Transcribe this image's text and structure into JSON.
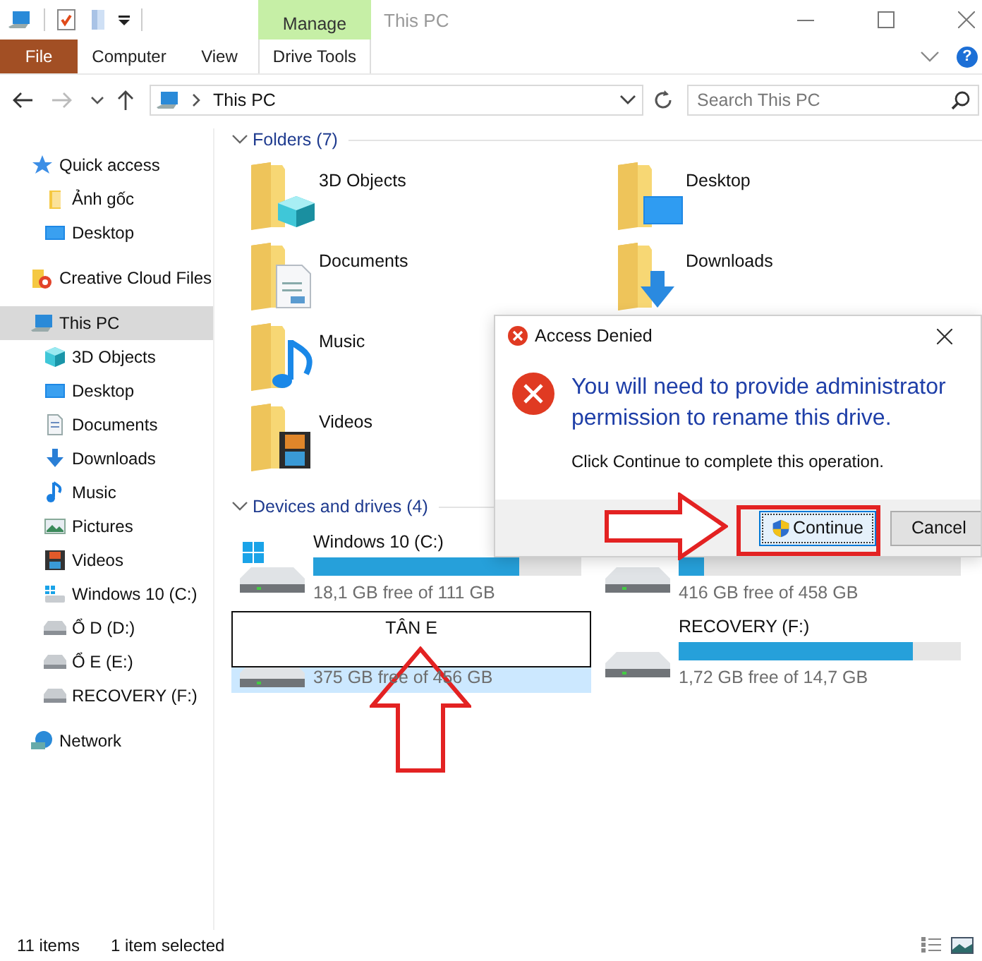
{
  "window": {
    "title": "This PC",
    "context_group": "Manage"
  },
  "ribbon": {
    "tabs": [
      {
        "label": "File",
        "kind": "file"
      },
      {
        "label": "Computer",
        "kind": "normal"
      },
      {
        "label": "View",
        "kind": "normal"
      },
      {
        "label": "Drive Tools",
        "kind": "context"
      }
    ],
    "help": "?"
  },
  "address": {
    "location": "This PC"
  },
  "search": {
    "placeholder": "Search This PC"
  },
  "sidebar": {
    "items": [
      {
        "label": "Quick access",
        "kind": "star",
        "selected": false,
        "children": [
          {
            "label": "Ảnh gốc",
            "kind": "folder",
            "selected": false
          },
          {
            "label": "Desktop",
            "kind": "desktop",
            "selected": false
          }
        ]
      },
      {
        "label": "Creative Cloud Files",
        "kind": "cloud",
        "selected": false
      },
      {
        "label": "This PC",
        "kind": "pc",
        "selected": true,
        "children": [
          {
            "label": "3D Objects",
            "kind": "cube",
            "selected": false
          },
          {
            "label": "Desktop",
            "kind": "desktop",
            "selected": false
          },
          {
            "label": "Documents",
            "kind": "doc",
            "selected": false
          },
          {
            "label": "Downloads",
            "kind": "download",
            "selected": false
          },
          {
            "label": "Music",
            "kind": "music",
            "selected": false
          },
          {
            "label": "Pictures",
            "kind": "pictures",
            "selected": false
          },
          {
            "label": "Videos",
            "kind": "video",
            "selected": false
          },
          {
            "label": "Windows 10 (C:)",
            "kind": "windrive",
            "selected": false
          },
          {
            "label": "Ổ D (D:)",
            "kind": "drive",
            "selected": false
          },
          {
            "label": "Ổ E (E:)",
            "kind": "drive",
            "selected": false
          },
          {
            "label": "RECOVERY (F:)",
            "kind": "drive",
            "selected": false
          }
        ]
      },
      {
        "label": "Network",
        "kind": "network",
        "selected": false
      }
    ]
  },
  "folders": {
    "header": "Folders (7)",
    "columns": [
      [
        {
          "label": "3D Objects",
          "kind": "cube"
        },
        {
          "label": "Documents",
          "kind": "doc"
        },
        {
          "label": "Music",
          "kind": "music"
        },
        {
          "label": "Videos",
          "kind": "video"
        }
      ],
      [
        {
          "label": "Desktop",
          "kind": "desktop"
        },
        {
          "label": "Downloads",
          "kind": "download"
        }
      ]
    ]
  },
  "drives": {
    "header": "Devices and drives (4)",
    "items": [
      {
        "name": "Windows 10 (C:)",
        "kind": "windrive",
        "level": 0.77,
        "free": "18,1 GB free of 111 GB",
        "selected": false
      },
      {
        "kind": "drive",
        "level": 0.09,
        "free": "416 GB free of 458 GB",
        "selected": false
      },
      {
        "kind": "drive",
        "rename_value": "TÂN E",
        "free": "375 GB free of 456 GB",
        "selected": true
      },
      {
        "name": "RECOVERY (F:)",
        "kind": "drive",
        "level": 0.83,
        "free": "1,72 GB free of 14,7 GB",
        "selected": false
      }
    ]
  },
  "dialog": {
    "title": "Access Denied",
    "message": "You will need to provide administrator permission to rename this drive.",
    "detail": "Click Continue to complete this operation.",
    "buttons": [
      {
        "label": "Continue",
        "kind": "uac",
        "focused": true
      },
      {
        "label": "Cancel",
        "kind": "plain",
        "focused": false
      }
    ]
  },
  "status_bar": [
    "11 items",
    "1 item selected"
  ]
}
